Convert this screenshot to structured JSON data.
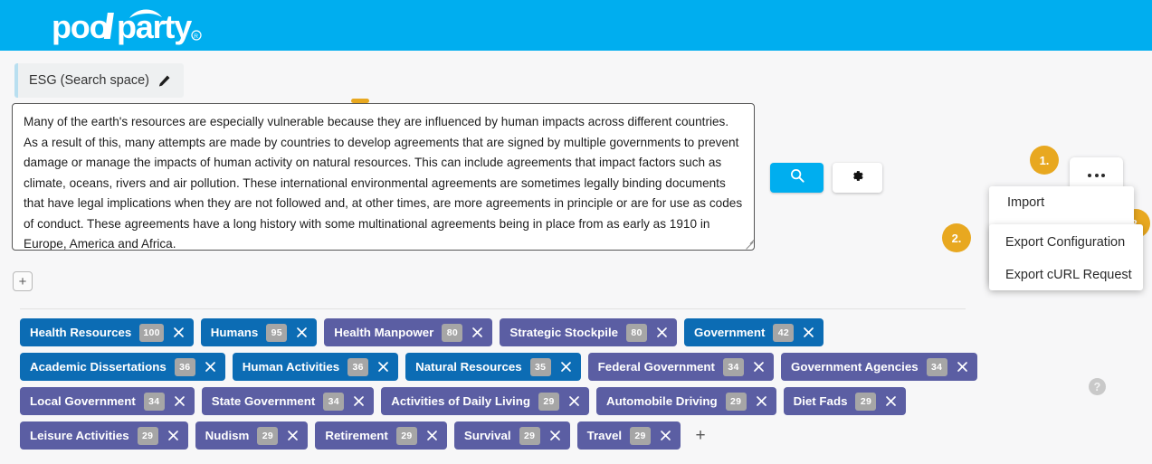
{
  "header": {
    "logo_text": "poolparty",
    "logo_mark": "registered-trademark"
  },
  "space_chip": {
    "label": "ESG (Search space)",
    "edit_icon": "pencil-icon"
  },
  "query": {
    "text": "Many of the earth's resources are especially vulnerable because they are influenced by human impacts across different countries. As a result of this, many attempts are made by countries to develop agreements that are signed by multiple governments to prevent damage or manage the impacts of human activity on natural resources. This can include agreements that impact factors such as climate, oceans, rivers and air pollution. These international environmental agreements are sometimes legally binding documents that have legal implications when they are not followed and, at other times, are more agreements in principle or are for use as codes of conduct. These agreements have a long history with some multinational agreements being in place from as early as 1910 in Europe, America and Africa."
  },
  "buttons": {
    "add_row": "+",
    "search_icon": "search-icon",
    "settings_icon": "gear-icon",
    "more_icon": "ellipsis-icon",
    "help_icon": "?"
  },
  "badges": [
    {
      "label": "1."
    },
    {
      "label": "2."
    },
    {
      "label": "3."
    }
  ],
  "menu": {
    "items": [
      {
        "label": "Import"
      }
    ],
    "submenu": [
      {
        "label": "Export Configuration"
      },
      {
        "label": "Export cURL Request"
      }
    ]
  },
  "tags": {
    "add_label": "+",
    "rows": [
      [
        {
          "label": "Health Resources",
          "count": "100",
          "color": "blue"
        },
        {
          "label": "Humans",
          "count": "95",
          "color": "blue"
        },
        {
          "label": "Health Manpower",
          "count": "80",
          "color": "purple"
        },
        {
          "label": "Strategic Stockpile",
          "count": "80",
          "color": "purple"
        },
        {
          "label": "Government",
          "count": "42",
          "color": "blue"
        }
      ],
      [
        {
          "label": "Academic Dissertations",
          "count": "36",
          "color": "blue"
        },
        {
          "label": "Human Activities",
          "count": "36",
          "color": "blue"
        },
        {
          "label": "Natural Resources",
          "count": "35",
          "color": "blue"
        },
        {
          "label": "Federal Government",
          "count": "34",
          "color": "purple"
        },
        {
          "label": "Government Agencies",
          "count": "34",
          "color": "purple"
        }
      ],
      [
        {
          "label": "Local Government",
          "count": "34",
          "color": "purple"
        },
        {
          "label": "State Government",
          "count": "34",
          "color": "purple"
        },
        {
          "label": "Activities of Daily Living",
          "count": "29",
          "color": "purple"
        },
        {
          "label": "Automobile Driving",
          "count": "29",
          "color": "purple"
        },
        {
          "label": "Diet Fads",
          "count": "29",
          "color": "purple"
        }
      ],
      [
        {
          "label": "Leisure Activities",
          "count": "29",
          "color": "purple"
        },
        {
          "label": "Nudism",
          "count": "29",
          "color": "purple"
        },
        {
          "label": "Retirement",
          "count": "29",
          "color": "purple"
        },
        {
          "label": "Survival",
          "count": "29",
          "color": "purple"
        },
        {
          "label": "Travel",
          "count": "29",
          "color": "purple"
        }
      ]
    ]
  },
  "colors": {
    "brand": "#00AEEF",
    "tag_blue": "#0c6cb4",
    "tag_purple": "#5b5ea3",
    "badge_orange": "#E8A820"
  }
}
